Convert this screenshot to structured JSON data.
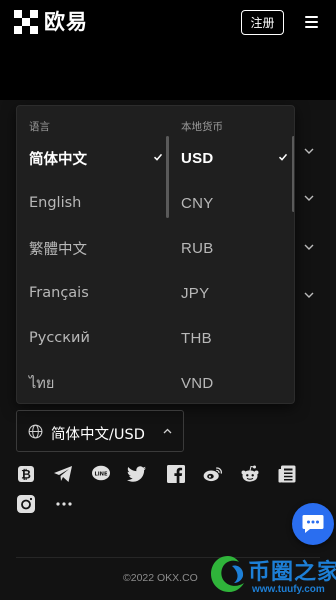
{
  "header": {
    "logo_text": "欧易",
    "register_label": "注册",
    "logo_icon": "okx-grid-logo",
    "menu_icon": "hamburger-menu-icon"
  },
  "dropdown": {
    "language_header": "语言",
    "currency_header": "本地货币",
    "languages": [
      {
        "label": "简体中文",
        "selected": true
      },
      {
        "label": "English",
        "selected": false
      },
      {
        "label": "繁體中文",
        "selected": false
      },
      {
        "label": "Français",
        "selected": false
      },
      {
        "label": "Русский",
        "selected": false
      },
      {
        "label": "ไทย",
        "selected": false
      }
    ],
    "currencies": [
      {
        "label": "USD",
        "selected": true
      },
      {
        "label": "CNY",
        "selected": false
      },
      {
        "label": "RUB",
        "selected": false
      },
      {
        "label": "JPY",
        "selected": false
      },
      {
        "label": "THB",
        "selected": false
      },
      {
        "label": "VND",
        "selected": false
      }
    ]
  },
  "language_selector": {
    "label": "简体中文/USD",
    "icon": "globe-icon"
  },
  "social_icons": [
    "bitcoin-icon",
    "telegram-icon",
    "line-icon",
    "twitter-icon",
    "facebook-icon",
    "weibo-icon",
    "reddit-icon",
    "news-icon",
    "instagram-icon",
    "more-icon"
  ],
  "footer": {
    "copyright": "©2022 OKX.CO"
  },
  "watermark": {
    "title": "币圈之家",
    "url": "www.tuufy.com"
  },
  "colors": {
    "background": "#121212",
    "popup": "#1f1f1f",
    "chat_button": "#2a6ef0",
    "watermark": "#1d7fd6"
  }
}
